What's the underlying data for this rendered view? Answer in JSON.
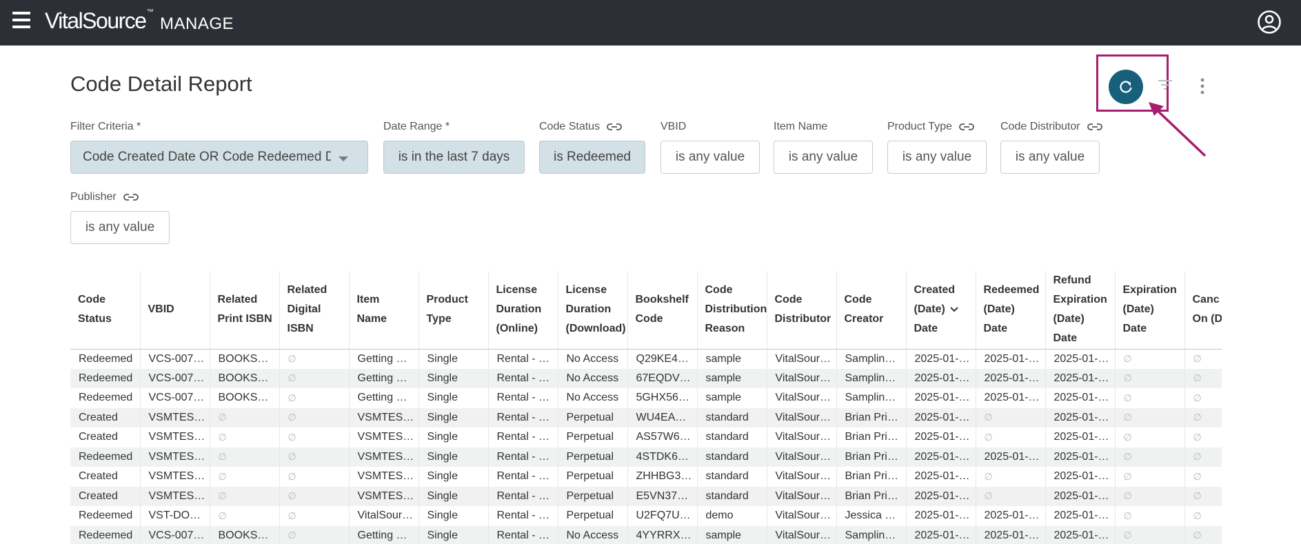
{
  "app": {
    "brand": "VitalSource",
    "brand_tm": "™",
    "product": "MANAGE"
  },
  "icons": {
    "menu": "hamburger-icon",
    "account": "account-circle-icon",
    "refresh": "refresh-icon",
    "filter": "filter-icon",
    "more": "more-vert-icon",
    "link": "link-icon",
    "sort": "chevron-down-icon"
  },
  "colors": {
    "topbar": "#2d2f36",
    "accent": "#175f7a",
    "highlight": "#a61c6e",
    "chip_active": "#d3e0e5"
  },
  "page": {
    "title": "Code Detail Report"
  },
  "filters": {
    "filter_criteria": {
      "label": "Filter Criteria",
      "required": "*",
      "value": "Code Created Date OR Code Redeemed Date"
    },
    "date_range": {
      "label": "Date Range",
      "required": "*",
      "value": "is in the last 7 days"
    },
    "code_status": {
      "label": "Code Status",
      "value": "is Redeemed"
    },
    "vbid": {
      "label": "VBID",
      "value": "is any value"
    },
    "item_name": {
      "label": "Item Name",
      "value": "is any value"
    },
    "product_type": {
      "label": "Product Type",
      "value": "is any value"
    },
    "code_distributor": {
      "label": "Code Distributor",
      "value": "is any value"
    },
    "publisher": {
      "label": "Publisher",
      "value": "is any value"
    }
  },
  "table": {
    "columns": [
      [
        "Code",
        "Status"
      ],
      [
        "VBID"
      ],
      [
        "Related",
        "Print ISBN"
      ],
      [
        "Related",
        "Digital",
        "ISBN"
      ],
      [
        "Item",
        "Name"
      ],
      [
        "Product",
        "Type"
      ],
      [
        "License",
        "Duration",
        "(Online)"
      ],
      [
        "License",
        "Duration",
        "(Download)"
      ],
      [
        "Bookshelf",
        "Code"
      ],
      [
        "Code",
        "Distribution",
        "Reason"
      ],
      [
        "Code",
        "Distributor"
      ],
      [
        "Code",
        "Creator"
      ],
      [
        "Created",
        "(Date)",
        "Date"
      ],
      [
        "Redeemed",
        "(Date)",
        "Date"
      ],
      [
        "Refund",
        "Expiration",
        "(Date)",
        "Date"
      ],
      [
        "Expiration",
        "(Date)",
        "Date"
      ],
      [
        "Canc",
        "On (D"
      ]
    ],
    "null_symbol": "∅",
    "rows": [
      [
        "Redeemed",
        "VCS-007…",
        "BOOKSH…",
        "",
        "Getting S…",
        "Single",
        "Rental - …",
        "No Access",
        "Q29KE4…",
        "sample",
        "VitalSour…",
        "Samplin…",
        "2025-01-…",
        "2025-01-…",
        "2025-01-…",
        "",
        ""
      ],
      [
        "Redeemed",
        "VCS-007…",
        "BOOKSH…",
        "",
        "Getting S…",
        "Single",
        "Rental - …",
        "No Access",
        "67EQDV…",
        "sample",
        "VitalSour…",
        "Samplin…",
        "2025-01-…",
        "2025-01-…",
        "2025-01-…",
        "",
        ""
      ],
      [
        "Redeemed",
        "VCS-007…",
        "BOOKSH…",
        "",
        "Getting S…",
        "Single",
        "Rental - …",
        "No Access",
        "5GHX56…",
        "sample",
        "VitalSour…",
        "Samplin…",
        "2025-01-…",
        "2025-01-…",
        "2025-01-…",
        "",
        ""
      ],
      [
        "Created",
        "VSMTES…",
        "",
        "",
        "VSMTES…",
        "Single",
        "Rental - …",
        "Perpetual",
        "WU4EAP…",
        "standard",
        "VitalSour…",
        "Brian Pri…",
        "2025-01-…",
        "",
        "2025-01-…",
        "",
        ""
      ],
      [
        "Created",
        "VSMTES…",
        "",
        "",
        "VSMTES…",
        "Single",
        "Rental - …",
        "Perpetual",
        "AS57W6…",
        "standard",
        "VitalSour…",
        "Brian Pri…",
        "2025-01-…",
        "",
        "2025-01-…",
        "",
        ""
      ],
      [
        "Redeemed",
        "VSMTES…",
        "",
        "",
        "VSMTES…",
        "Single",
        "Rental - …",
        "Perpetual",
        "4STDK6…",
        "standard",
        "VitalSour…",
        "Brian Pri…",
        "2025-01-…",
        "2025-01-…",
        "2025-01-…",
        "",
        ""
      ],
      [
        "Created",
        "VSMTES…",
        "",
        "",
        "VSMTES…",
        "Single",
        "Rental - …",
        "Perpetual",
        "ZHHBG3…",
        "standard",
        "VitalSour…",
        "Brian Pri…",
        "2025-01-…",
        "",
        "2025-01-…",
        "",
        ""
      ],
      [
        "Created",
        "VSMTES…",
        "",
        "",
        "VSMTES…",
        "Single",
        "Rental - …",
        "Perpetual",
        "E5VN37…",
        "standard",
        "VitalSour…",
        "Brian Pri…",
        "2025-01-…",
        "",
        "2025-01-…",
        "",
        ""
      ],
      [
        "Redeemed",
        "VST-DOC…",
        "",
        "",
        "VitalSour…",
        "Single",
        "Rental - …",
        "Perpetual",
        "U2FQ7U…",
        "demo",
        "VitalSour…",
        "Jessica …",
        "2025-01-…",
        "2025-01-…",
        "2025-01-…",
        "",
        ""
      ],
      [
        "Redeemed",
        "VCS-007…",
        "BOOKSH…",
        "",
        "Getting S…",
        "Single",
        "Rental - …",
        "No Access",
        "4YYRRX…",
        "sample",
        "VitalSour…",
        "Samplin…",
        "2025-01-…",
        "2025-01-…",
        "2025-01-…",
        "",
        ""
      ]
    ]
  }
}
